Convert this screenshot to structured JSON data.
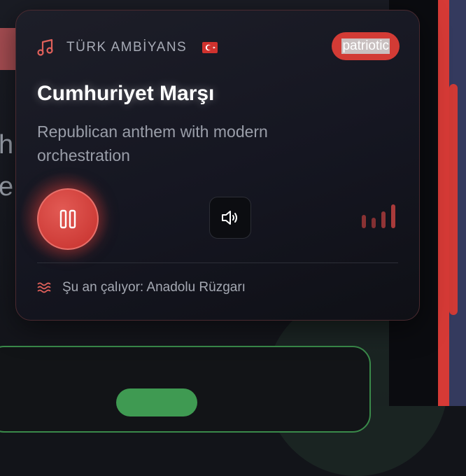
{
  "background": {
    "fragment_text_1": "h",
    "fragment_text_2": "e"
  },
  "player": {
    "brand": "TÜRK AMBİYANS",
    "brand_icon": "music-note-icon",
    "flag": "turkey-flag",
    "tag": "patriotic",
    "title": "Cumhuriyet Marşı",
    "subtitle": "Republican anthem with modern orchestration",
    "play_state": "playing",
    "now_playing_icon": "waves-icon",
    "now_playing": "Şu an çalıyor: Anadolu Rüzgarı",
    "eq_levels": [
      0.55,
      0.45,
      0.7,
      1.0
    ]
  },
  "colors": {
    "accent": "#d23b35",
    "card_border": "#4a2a30",
    "text_primary": "#ffffff",
    "text_secondary": "#9a9ea9",
    "scrollbar_track": "#343a5e"
  }
}
